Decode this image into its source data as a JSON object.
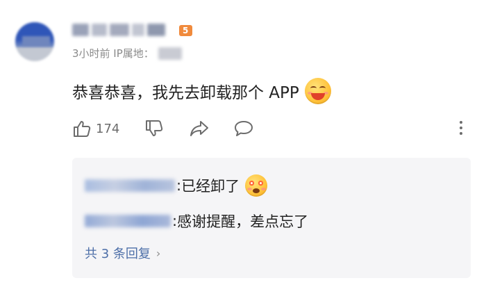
{
  "comment": {
    "username": "",
    "level_badge": "5",
    "meta": "3小时前 IP属地：",
    "text": "恭喜恭喜，我先去卸载那个 APP",
    "emoji_icon": "laughing-emoji-icon",
    "actions": {
      "like_count": "174"
    }
  },
  "replies": {
    "items": [
      {
        "author": "",
        "separator": ":",
        "text": "已经卸了",
        "emoji_icon": "starry-eyes-emoji-icon"
      },
      {
        "author": "",
        "separator": ":",
        "text": "感谢提醒，差点忘了"
      }
    ],
    "view_all_label": "共 3 条回复",
    "view_all_chevron": "›"
  },
  "colors": {
    "link": "#4d6fa8",
    "reply_bg": "#f5f5f7",
    "badge": "#f08a3c"
  }
}
